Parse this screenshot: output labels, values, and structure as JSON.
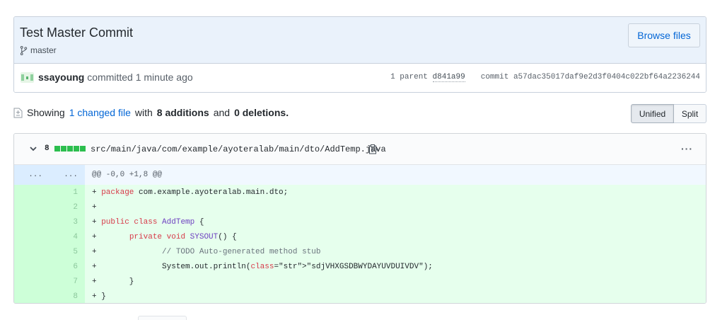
{
  "commit": {
    "title": "Test Master Commit",
    "branch": "master",
    "browse_files": "Browse files",
    "author": "ssayoung",
    "action": "committed",
    "time": "1 minute ago",
    "parent_label": "1 parent",
    "parent_sha": "d841a99",
    "commit_label": "commit",
    "commit_sha": "a57dac35017daf9e2d3f0404c022bf64a2236244"
  },
  "summary": {
    "prefix": "Showing",
    "changed_files": "1 changed file",
    "with": "with",
    "additions": "8 additions",
    "and": "and",
    "deletions": "0 deletions",
    "period": "."
  },
  "view_toggle": {
    "unified": "Unified",
    "split": "Split"
  },
  "file": {
    "changes": "8",
    "path": "src/main/java/com/example/ayoteralab/main/dto/AddTemp.java",
    "more": "···",
    "hunk": {
      "old_ln": "...",
      "new_ln": "...",
      "header": "@@ -0,0 +1,8 @@"
    },
    "lines": [
      {
        "num": "1",
        "code": "+ package com.example.ayoteralab.main.dto;"
      },
      {
        "num": "2",
        "code": "+"
      },
      {
        "num": "3",
        "code": "+ public class AddTemp {"
      },
      {
        "num": "4",
        "code": "+       private void SYSOUT() {"
      },
      {
        "num": "5",
        "code": "+              // TODO Auto-generated method stub"
      },
      {
        "num": "6",
        "code": "+              System.out.println(\"sdjVHXGSDBWYDAYUVDUIVDV\");"
      },
      {
        "num": "7",
        "code": "+       }"
      },
      {
        "num": "8",
        "code": "+ }"
      }
    ]
  },
  "colors": {
    "link": "#0366d6",
    "addition_bg": "#e6ffed",
    "addition_ln_bg": "#cdffd8",
    "diffstat_green": "#2cbe4e",
    "commit_header_bg": "#eaf2fb"
  }
}
